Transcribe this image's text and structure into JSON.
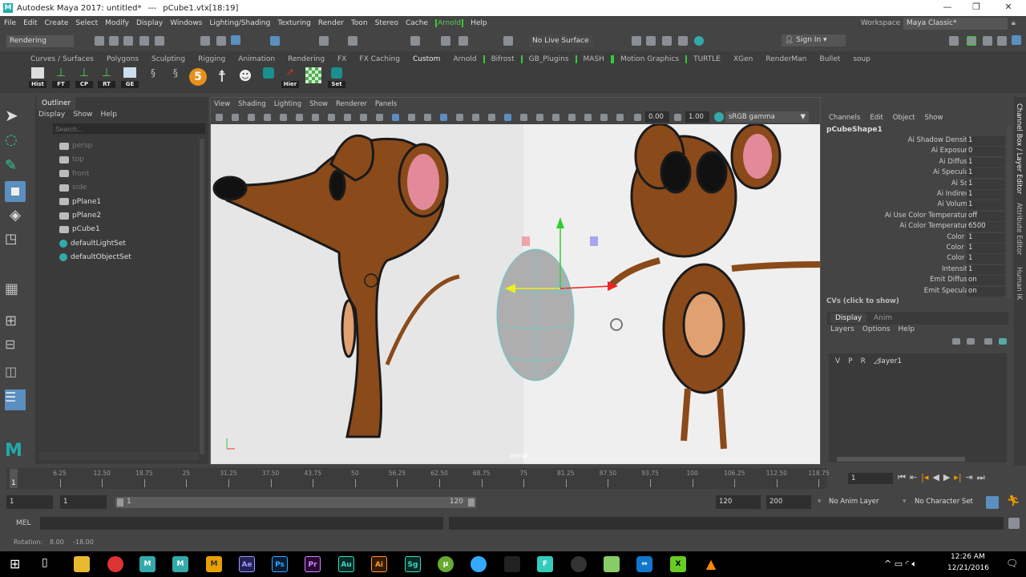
{
  "title": {
    "app": "Autodesk Maya 2017: untitled*",
    "sep": "---",
    "sel": "pCube1.vtx[18:19]"
  },
  "menu": [
    "File",
    "Edit",
    "Create",
    "Select",
    "Modify",
    "Display",
    "Windows",
    "Lighting/Shading",
    "Texturing",
    "Render",
    "Toon",
    "Stereo",
    "Cache",
    "Arnold",
    "Help"
  ],
  "workspace": {
    "label": "Workspace :",
    "value": "Maya Classic*"
  },
  "status": {
    "menuset": "Rendering",
    "live_surface": "No Live Surface",
    "sign_in": "Sign In"
  },
  "shelf": {
    "tabs": [
      "Curves / Surfaces",
      "Polygons",
      "Sculpting",
      "Rigging",
      "Animation",
      "Rendering",
      "FX",
      "FX Caching",
      "Custom",
      "Arnold",
      "Bifrost",
      "GB_Plugins",
      "MASH",
      "Motion Graphics",
      "TURTLE",
      "XGen",
      "RenderMan",
      "Bullet",
      "soup"
    ],
    "active": "Custom",
    "buttons": [
      "Hist",
      "FT",
      "CP",
      "RT",
      "GE",
      "Hier",
      "Set"
    ],
    "five": "5"
  },
  "outliner": {
    "title": "Outliner",
    "menu": [
      "Display",
      "Show",
      "Help"
    ],
    "search_placeholder": "Search...",
    "items": [
      "persp",
      "top",
      "front",
      "side",
      "pPlane1",
      "pPlane2",
      "pCube1",
      "defaultLightSet",
      "defaultObjectSet"
    ]
  },
  "viewport": {
    "menu": [
      "View",
      "Shading",
      "Lighting",
      "Show",
      "Renderer",
      "Panels"
    ],
    "exposure": "0.00",
    "gamma": "1.00",
    "colorspace": "sRGB gamma",
    "camera_label": "persp"
  },
  "channelbox": {
    "menu": [
      "Channels",
      "Edit",
      "Object",
      "Show"
    ],
    "node": "pCubeShape1",
    "attrs": [
      [
        "Ai Shadow Density",
        "1"
      ],
      [
        "Ai Exposure",
        "0"
      ],
      [
        "Ai Diffuse",
        "1"
      ],
      [
        "Ai Specular",
        "1"
      ],
      [
        "Ai Sss",
        "1"
      ],
      [
        "Ai Indirect",
        "1"
      ],
      [
        "Ai Volume",
        "1"
      ],
      [
        "Ai Use Color Temperature",
        "off"
      ],
      [
        "Ai Color Temperature",
        "6500"
      ],
      [
        "Color R",
        "1"
      ],
      [
        "Color G",
        "1"
      ],
      [
        "Color B",
        "1"
      ],
      [
        "Intensity",
        "1"
      ],
      [
        "Emit Diffuse",
        "on"
      ],
      [
        "Emit Specular",
        "on"
      ]
    ],
    "cvs": "CVs (click to show)"
  },
  "layers": {
    "tabs": [
      "Display",
      "Anim"
    ],
    "menu": [
      "Layers",
      "Options",
      "Help"
    ],
    "row": {
      "v": "V",
      "p": "P",
      "r": "R",
      "name": "layer1"
    }
  },
  "side_tabs": [
    "Channel Box / Layer Editor",
    "Attribute Editor",
    "Human IK"
  ],
  "timeline": {
    "ticks": [
      "6.25",
      "12.50",
      "18.75",
      "25",
      "31.25",
      "37.50",
      "43.75",
      "50",
      "56.25",
      "62.50",
      "68.75",
      "75",
      "81.25",
      "87.50",
      "93.75",
      "100",
      "106.25",
      "112.50",
      "118.75"
    ],
    "current": "1",
    "current_field": "1"
  },
  "range": {
    "start": "1",
    "start2": "1",
    "slider_start": "1",
    "slider_end": "120",
    "end": "120",
    "end2": "200",
    "anim_layer": "No Anim Layer",
    "char_set": "No Character Set"
  },
  "cmdline": {
    "label": "MEL"
  },
  "helpline": {
    "label": "Rotation:",
    "x": "8.00",
    "y": "-18.00"
  },
  "taskbar": {
    "apps": [
      "Ae",
      "Ps",
      "Pr",
      "Au",
      "Ai",
      "Sg"
    ],
    "time": "12:26 AM",
    "date": "12/21/2016",
    "notif": "1"
  }
}
